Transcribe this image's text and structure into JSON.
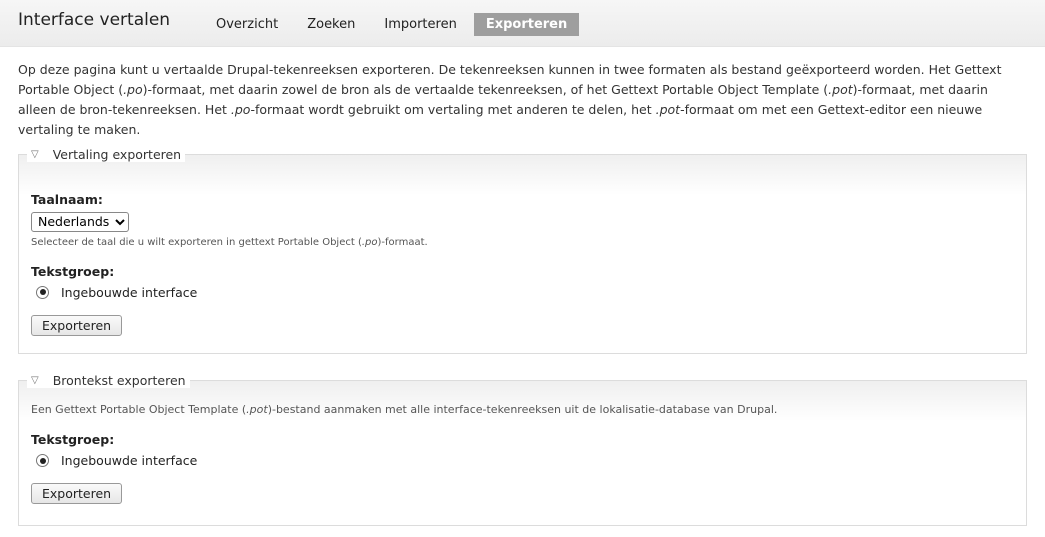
{
  "header": {
    "title": "Interface vertalen",
    "tabs": [
      {
        "label": "Overzicht"
      },
      {
        "label": "Zoeken"
      },
      {
        "label": "Importeren"
      },
      {
        "label": "Exporteren"
      }
    ]
  },
  "intro": {
    "p1": "Op deze pagina kunt u vertaalde Drupal-tekenreeksen exporteren. De tekenreeksen kunnen in twee formaten als bestand geëxporteerd worden. Het Gettext Portable Object (",
    "ext_po": ".po",
    "p2": ")-formaat, met daarin zowel de bron als de vertaalde tekenreeksen, of het Gettext Portable Object Template (",
    "ext_pot": ".pot",
    "p3": ")-formaat, met daarin alleen de bron-tekenreeksen. Het ",
    "ext_po2": ".po",
    "p4": "-formaat wordt gebruikt om vertaling met anderen te delen, het ",
    "ext_pot2": ".pot",
    "p5": "-formaat om met een Gettext-editor een nieuwe vertaling te maken."
  },
  "fieldset_translation": {
    "legend": "Vertaling exporteren",
    "language_label": "Taalnaam:",
    "language_selected": "Nederlands",
    "language_desc_1": "Selecteer de taal die u wilt exporteren in gettext Portable Object (",
    "language_desc_ext": ".po",
    "language_desc_2": ")-formaat.",
    "textgroup_label": "Tekstgroep:",
    "textgroup_option": "Ingebouwde interface",
    "button": "Exporteren"
  },
  "fieldset_source": {
    "legend": "Brontekst exporteren",
    "desc_1": "Een Gettext Portable Object Template (",
    "desc_ext": ".pot",
    "desc_2": ")-bestand aanmaken met alle interface-tekenreeksen uit de lokalisatie-database van Drupal.",
    "textgroup_label": "Tekstgroep:",
    "textgroup_option": "Ingebouwde interface",
    "button": "Exporteren"
  }
}
